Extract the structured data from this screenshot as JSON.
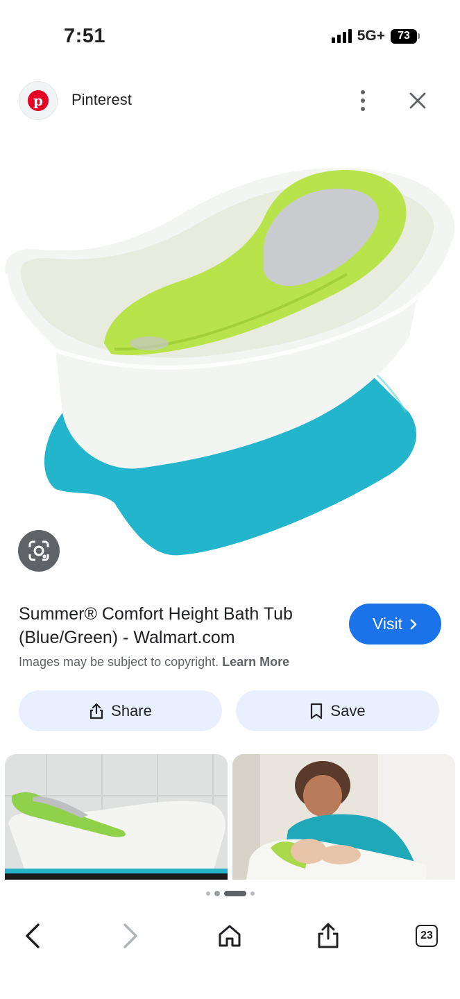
{
  "status_bar": {
    "time": "7:51",
    "network": "5G+",
    "battery": "73"
  },
  "header": {
    "source_name": "Pinterest",
    "logo_letter": "p",
    "icons": [
      "pinterest-logo",
      "more-vert-icon",
      "close-icon"
    ]
  },
  "hero": {
    "colors": {
      "tub": "#f5f7f4",
      "seat": "#b8e34a",
      "base": "#22b5cc",
      "pad": "#c9ccce"
    }
  },
  "info": {
    "title": "Summer® Comfort Height Bath Tub (Blue/Green) - Walmart.com",
    "visit_label": "Visit",
    "copyright_text": "Images may be subject to copyright.",
    "learn_more_label": "Learn More"
  },
  "actions": {
    "share_label": "Share",
    "save_label": "Save"
  },
  "toolbar": {
    "tabs_count": "23",
    "icons": [
      "back-icon",
      "forward-icon",
      "home-icon",
      "share-icon",
      "tabs-icon"
    ]
  },
  "colors": {
    "accent": "#1a73e8",
    "chip_bg": "#e8f0fe",
    "pinterest_red": "#e60023"
  }
}
